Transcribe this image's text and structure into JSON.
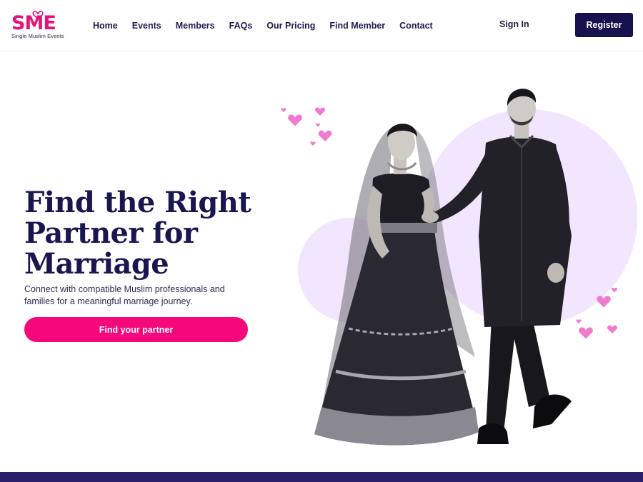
{
  "brand": {
    "logo_text": "SME",
    "caption": "Single Muslim Events",
    "colors": {
      "magenta": "#e5147d",
      "navy": "#17124f",
      "accent": "#f5087a",
      "lavender": "#f1e6fd"
    }
  },
  "nav": {
    "items": [
      "Home",
      "Events",
      "Members",
      "FAQs",
      "Our Pricing",
      "Find Member",
      "Contact"
    ]
  },
  "auth": {
    "signin_label": "Sign In",
    "register_label": "Register"
  },
  "hero": {
    "title": "Find the Right Partner for Marriage",
    "subtitle": "Connect with compatible Muslim professionals and families for a meaningful marriage journey.",
    "cta_label": "Find your partner",
    "image_subject": "bride-and-groom-illustration",
    "decor_icon": "heart-icon"
  }
}
